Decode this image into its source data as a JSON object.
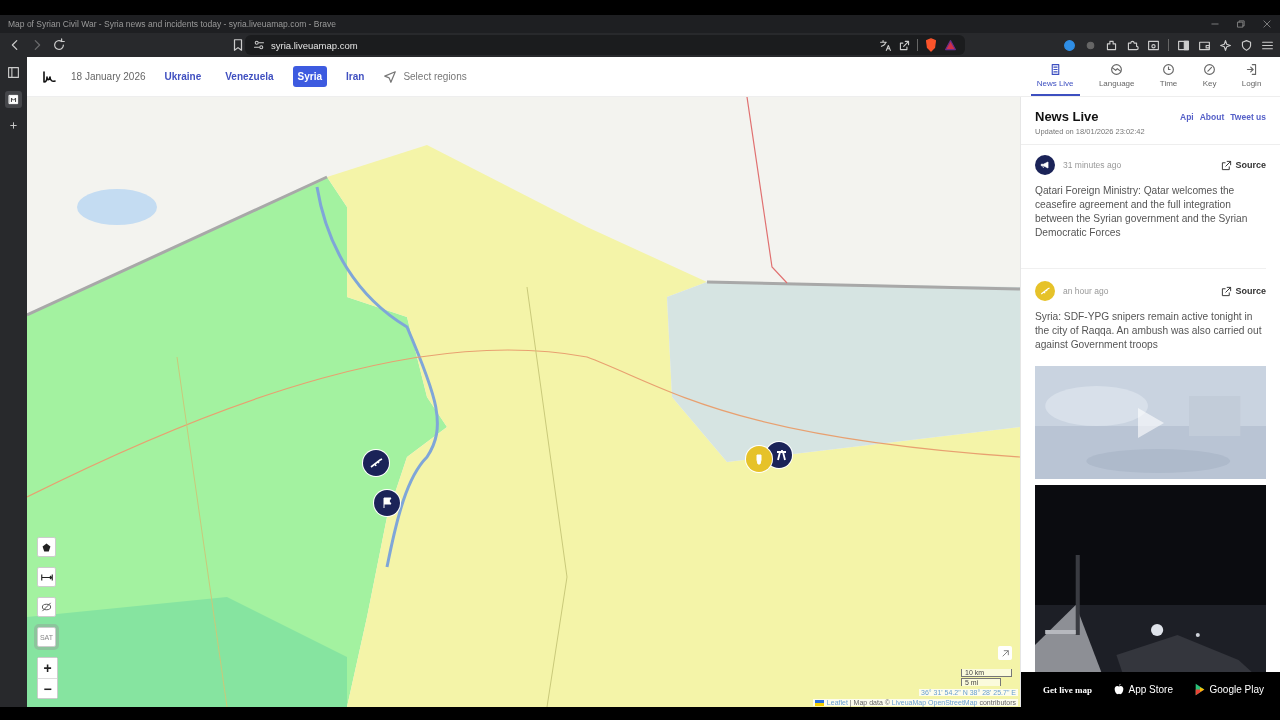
{
  "browser": {
    "title": "Map of Syrian Civil War - Syria news and incidents today - syria.liveuamap.com - Brave",
    "url": "syria.liveuamap.com"
  },
  "site": {
    "date": "18 January 2026",
    "regions": [
      {
        "label": "Ukraine",
        "selected": false
      },
      {
        "label": "Venezuela",
        "selected": false
      },
      {
        "label": "Syria",
        "selected": true
      },
      {
        "label": "Iran",
        "selected": false
      }
    ],
    "select_regions": "Select regions",
    "nav": [
      {
        "kind": "news",
        "label": "News Live",
        "selected": true
      },
      {
        "kind": "language",
        "label": "Language",
        "selected": false
      },
      {
        "kind": "time",
        "label": "Time",
        "selected": false
      },
      {
        "kind": "key",
        "label": "Key",
        "selected": false
      },
      {
        "kind": "login",
        "label": "Login",
        "selected": false
      }
    ]
  },
  "map": {
    "markers": [
      {
        "kind": "rifle",
        "color": "#1b2358"
      },
      {
        "kind": "flag",
        "color": "#1b2358"
      },
      {
        "kind": "gun",
        "color": "#1b2358"
      },
      {
        "kind": "fist",
        "color": "#e6c229"
      }
    ],
    "sat": "SAT",
    "zoom_in": "+",
    "zoom_out": "−",
    "scale": [
      "10 km",
      "5 mi"
    ],
    "coordinates": "36° 31' 54.2\" N 38° 28' 25.7\" E",
    "attribution": [
      {
        "text": "Leaflet",
        "link": true
      },
      {
        "text": "| Map data ©",
        "link": false
      },
      {
        "text": "LiveuaMap",
        "link": true
      },
      {
        "text": "OpenStreetMap",
        "link": true
      },
      {
        "text": "contributors",
        "link": false
      }
    ]
  },
  "news": {
    "title": "News Live",
    "links": [
      "Api",
      "About",
      "Tweet us"
    ],
    "updated": "Updated on 18/01/2026 23:02:42",
    "items": [
      {
        "kind": "megaphone",
        "color": "#1b2358",
        "time": "31 minutes ago",
        "source": "Source",
        "text": "Qatari Foreign Ministry: Qatar welcomes the ceasefire agreement and the full integration between the Syrian government and the Syrian Democratic Forces"
      },
      {
        "kind": "rifle",
        "color": "#e6c229",
        "time": "an hour ago",
        "source": "Source",
        "text": "Syria: SDF-YPG snipers remain active tonight in the city of Raqqa. An ambush was also carried out against Government troops"
      }
    ],
    "media": [
      {
        "kind": "day",
        "play_button": true
      },
      {
        "kind": "night",
        "play_button": false
      }
    ]
  },
  "footer": {
    "label": "Get live map",
    "stores": [
      {
        "kind": "apple",
        "label": "App Store"
      },
      {
        "kind": "google",
        "label": "Google Play"
      }
    ]
  }
}
